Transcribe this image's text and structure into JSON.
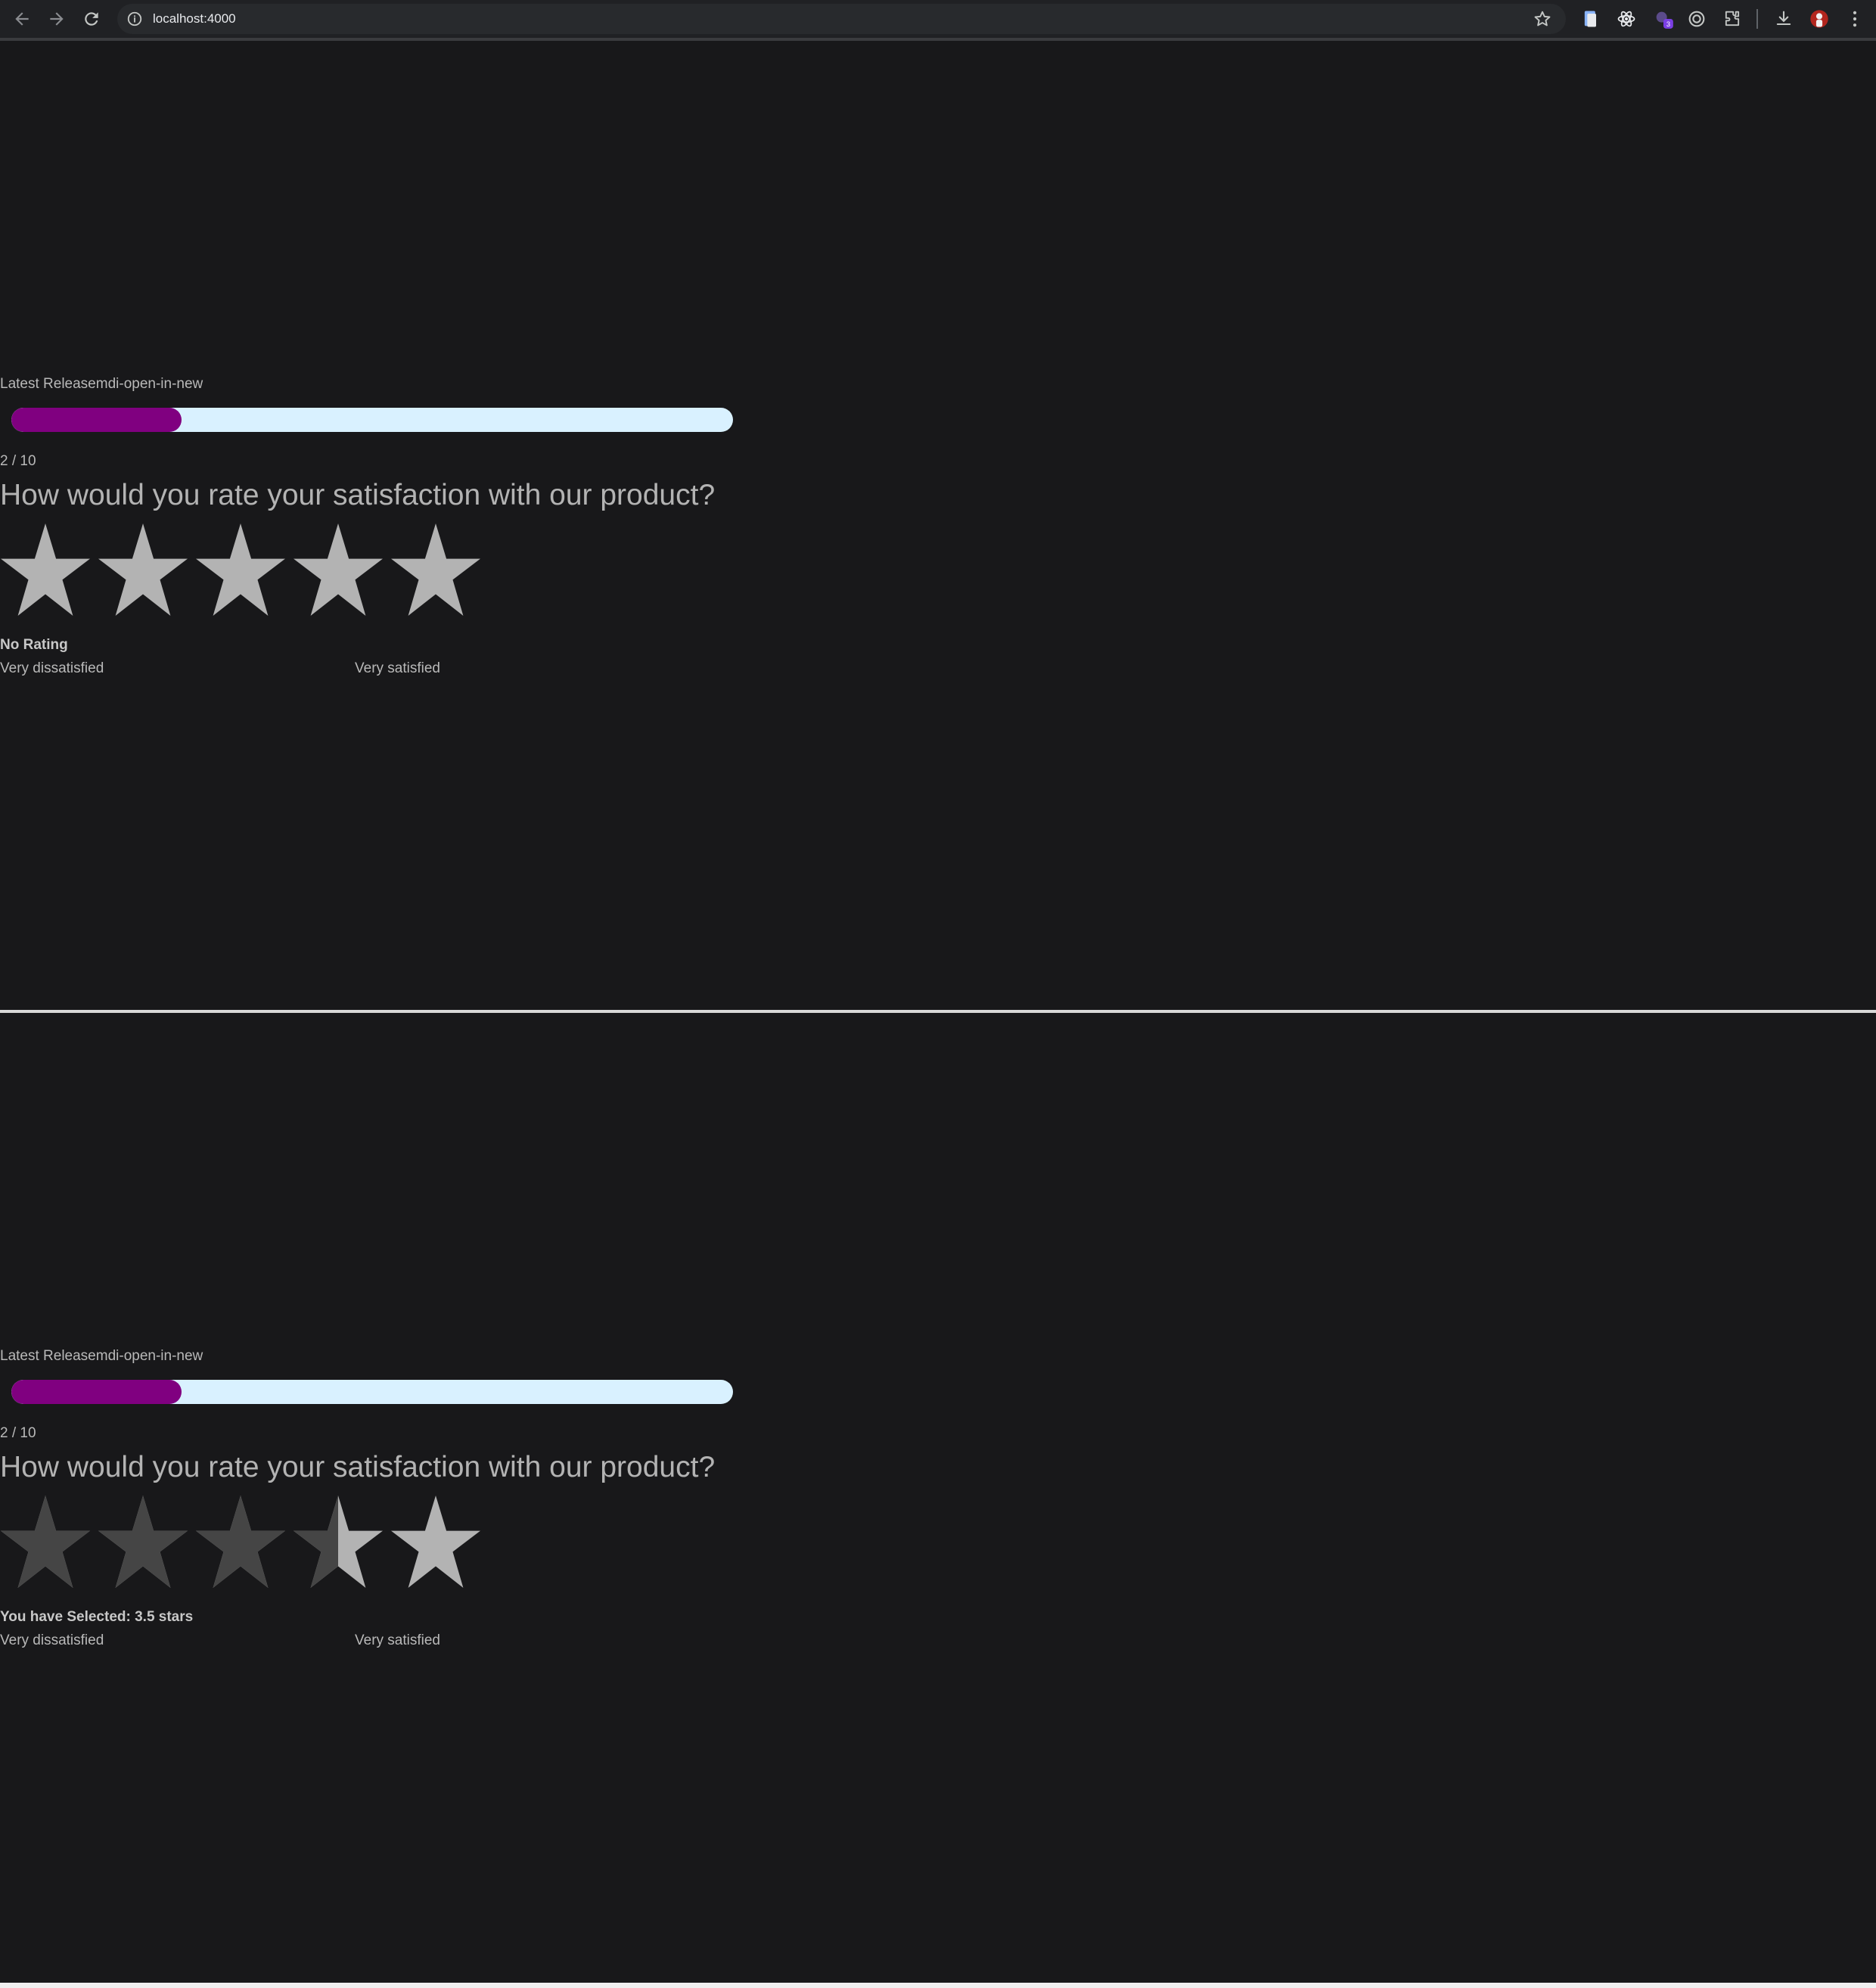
{
  "browser": {
    "url": "localhost:4000",
    "extension_badge": "3"
  },
  "survey_states": [
    {
      "release_link": "Latest Releasemdi-open-in-new",
      "progress_fraction": 0.2,
      "step_counter": "2 / 10",
      "question": "How would you rate your satisfaction with our product?",
      "star_count": 5,
      "rating_value": 0,
      "rating_status": "No Rating",
      "low_label": "Very dissatisfied",
      "high_label": "Very satisfied"
    },
    {
      "release_link": "Latest Releasemdi-open-in-new",
      "progress_fraction": 0.2,
      "step_counter": "2 / 10",
      "question": "How would you rate your satisfaction with our product?",
      "star_count": 5,
      "rating_value": 3.5,
      "rating_status": "You have Selected: 3.5 stars",
      "low_label": "Very dissatisfied",
      "high_label": "Very satisfied"
    }
  ],
  "colors": {
    "page_background": "#18181a",
    "progress_fill": "#800080",
    "progress_track": "#d9f1ff",
    "star_selected": "#454545",
    "star_unselected": "#b3b3b3",
    "text": "#b9b9b9"
  }
}
